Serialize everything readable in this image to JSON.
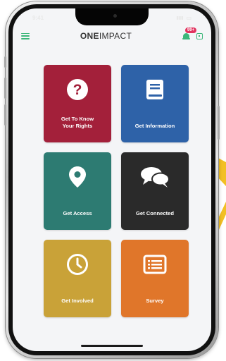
{
  "statusbar": {
    "time": "9:41",
    "signal": "▮▮▮",
    "battery": "▭"
  },
  "header": {
    "logo_bold": "ONE",
    "logo_light": "IMPACT",
    "notification_badge": "99+"
  },
  "tiles": [
    {
      "label": "Get To Know\nYour Rights",
      "icon": "question-circle-icon",
      "color": "#a3203a"
    },
    {
      "label": "Get Information",
      "icon": "book-icon",
      "color": "#2e62a8"
    },
    {
      "label": "Get Access",
      "icon": "location-pin-icon",
      "color": "#2d7b72"
    },
    {
      "label": "Get Connected",
      "icon": "chat-bubbles-icon",
      "color": "#2a2a2a"
    },
    {
      "label": "Get Involved",
      "icon": "clock-icon",
      "color": "#c9a238"
    },
    {
      "label": "Survey",
      "icon": "list-icon",
      "color": "#e0762a"
    }
  ],
  "colors": {
    "accent": "#3cb77a",
    "badge": "#e2335f",
    "screen_bg": "#f4f5f7",
    "decor_arrow": "#f2c024"
  }
}
